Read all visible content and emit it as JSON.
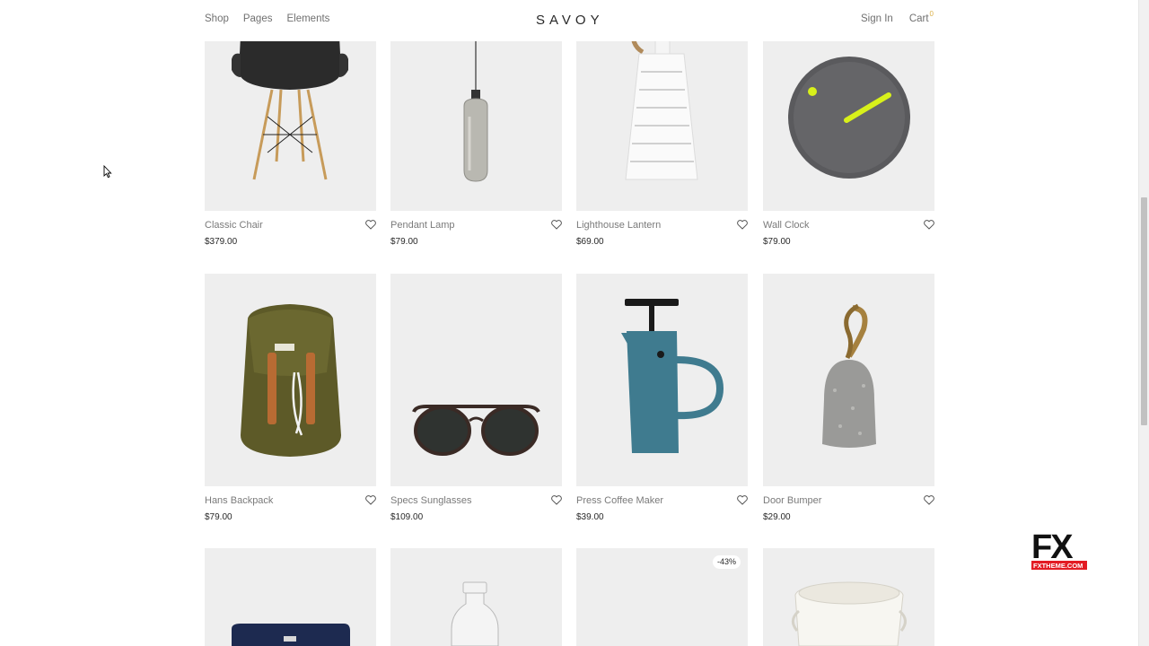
{
  "header": {
    "nav_left": [
      "Shop",
      "Pages",
      "Elements"
    ],
    "logo": "SAVOY",
    "sign_in": "Sign In",
    "cart_label": "Cart",
    "cart_count": "0"
  },
  "products": [
    {
      "title": "Classic Chair",
      "price": "$379.00",
      "icon": "chair"
    },
    {
      "title": "Pendant Lamp",
      "price": "$79.00",
      "icon": "pendant-lamp"
    },
    {
      "title": "Lighthouse Lantern",
      "price": "$69.00",
      "icon": "lantern"
    },
    {
      "title": "Wall Clock",
      "price": "$79.00",
      "icon": "wall-clock"
    },
    {
      "title": "Hans Backpack",
      "price": "$79.00",
      "icon": "backpack"
    },
    {
      "title": "Specs Sunglasses",
      "price": "$109.00",
      "icon": "sunglasses"
    },
    {
      "title": "Press Coffee Maker",
      "price": "$39.00",
      "icon": "coffee-press"
    },
    {
      "title": "Door Bumper",
      "price": "$29.00",
      "icon": "door-bumper"
    },
    {
      "icon": "notebook"
    },
    {
      "icon": "glass-bottle"
    },
    {
      "badge": "-43%"
    },
    {
      "icon": "canvas-bag"
    }
  ],
  "watermark": {
    "big": "FX",
    "small": "FXTHEME.COM"
  },
  "colors": {
    "thumb_bg": "#eeeeee",
    "accent": "#dcb14a",
    "watermark_red": "#e31b23"
  }
}
